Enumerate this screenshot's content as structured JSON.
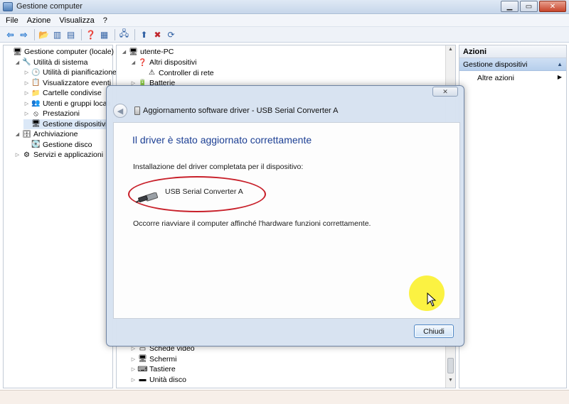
{
  "window": {
    "title": "Gestione computer"
  },
  "menu": [
    "File",
    "Azione",
    "Visualizza",
    "?"
  ],
  "left_tree": {
    "items": [
      {
        "label": "Gestione computer (locale)",
        "level": 0,
        "expander": "",
        "icon": "computer-management-icon",
        "glyph": "🖥"
      },
      {
        "label": "Utilità di sistema",
        "level": 1,
        "expander": "◢",
        "icon": "tools-icon",
        "glyph": "🔧"
      },
      {
        "label": "Utilità di pianificazione",
        "level": 2,
        "expander": "▷",
        "icon": "clock-icon",
        "glyph": "🕒"
      },
      {
        "label": "Visualizzatore eventi",
        "level": 2,
        "expander": "▷",
        "icon": "event-viewer-icon",
        "glyph": "📋"
      },
      {
        "label": "Cartelle condivise",
        "level": 2,
        "expander": "▷",
        "icon": "shared-folder-icon",
        "glyph": "📁"
      },
      {
        "label": "Utenti e gruppi locali",
        "level": 2,
        "expander": "▷",
        "icon": "users-icon",
        "glyph": "👥"
      },
      {
        "label": "Prestazioni",
        "level": 2,
        "expander": "▷",
        "icon": "performance-icon",
        "glyph": "⦸"
      },
      {
        "label": "Gestione dispositivi",
        "level": 2,
        "expander": "",
        "icon": "device-manager-icon",
        "glyph": "🖥",
        "selected": true
      },
      {
        "label": "Archiviazione",
        "level": 1,
        "expander": "◢",
        "icon": "storage-icon",
        "glyph": "🗄"
      },
      {
        "label": "Gestione disco",
        "level": 2,
        "expander": "",
        "icon": "disk-icon",
        "glyph": "💽"
      },
      {
        "label": "Servizi e applicazioni",
        "level": 1,
        "expander": "▷",
        "icon": "services-icon",
        "glyph": "⚙"
      }
    ]
  },
  "device_tree": {
    "root": "utente-PC",
    "top_items": [
      {
        "label": "Altri dispositivi",
        "expander": "◢",
        "level": 1,
        "glyph": "❓",
        "icon": "other-devices-icon"
      },
      {
        "label": "Controller di rete",
        "expander": "",
        "level": 2,
        "glyph": "⚠",
        "icon": "warning-device-icon"
      },
      {
        "label": "Batterie",
        "expander": "▷",
        "level": 1,
        "glyph": "🔋",
        "icon": "battery-icon"
      }
    ],
    "bottom_items": [
      {
        "label": "Schede video",
        "expander": "▷",
        "glyph": "▭",
        "icon": "display-adapter-icon"
      },
      {
        "label": "Schermi",
        "expander": "▷",
        "glyph": "🖥",
        "icon": "monitor-icon"
      },
      {
        "label": "Tastiere",
        "expander": "▷",
        "glyph": "⌨",
        "icon": "keyboard-icon"
      },
      {
        "label": "Unità disco",
        "expander": "▷",
        "glyph": "▬",
        "icon": "disk-drive-icon"
      }
    ]
  },
  "actions": {
    "header": "Azioni",
    "section": "Gestione dispositivi",
    "more": "Altre azioni"
  },
  "dialog": {
    "title": "Aggiornamento software driver - USB Serial Converter A",
    "heading": "Il driver è stato aggiornato correttamente",
    "install_text": "Installazione del driver completata per il dispositivo:",
    "device_name": "USB Serial Converter A",
    "restart_text": "Occorre riavviare il computer affinché l'hardware funzioni correttamente.",
    "close_button": "Chiudi"
  },
  "colors": {
    "highlight_circle": "#c8202a",
    "cursor_halo": "#faf028",
    "heading_blue": "#1c3f94"
  }
}
